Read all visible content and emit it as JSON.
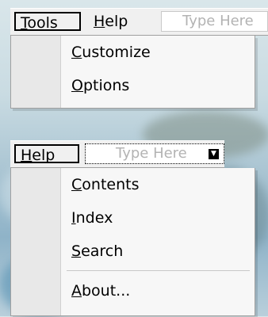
{
  "top_menubar": {
    "menus": [
      {
        "mnemonic": "T",
        "rest": "ools",
        "open": true
      },
      {
        "mnemonic": "H",
        "rest": "elp",
        "open": false
      }
    ],
    "typehere_text": "Type Here"
  },
  "tools_menu": {
    "items": [
      {
        "mnemonic": "C",
        "rest": "ustomize"
      },
      {
        "mnemonic": "O",
        "rest": "ptions"
      }
    ]
  },
  "bottom_menubar": {
    "menus": [
      {
        "mnemonic": "H",
        "rest": "elp",
        "open": true
      }
    ],
    "typehere_text": "Type Here"
  },
  "help_menu": {
    "items": [
      {
        "mnemonic": "C",
        "rest": "ontents"
      },
      {
        "mnemonic": "I",
        "rest": "ndex"
      },
      {
        "mnemonic": "S",
        "rest": "earch"
      },
      {
        "separator": true
      },
      {
        "mnemonic": "A",
        "rest": "bout..."
      }
    ]
  },
  "colors": {
    "menu_bg": "#f0f0f0",
    "dropdown_bg": "#f7f7f7",
    "gutter_bg": "#e8e8e8",
    "typehere_text": "#b3b3b3"
  },
  "icons": {
    "dropdown_arrow": "chevron-down-icon"
  }
}
